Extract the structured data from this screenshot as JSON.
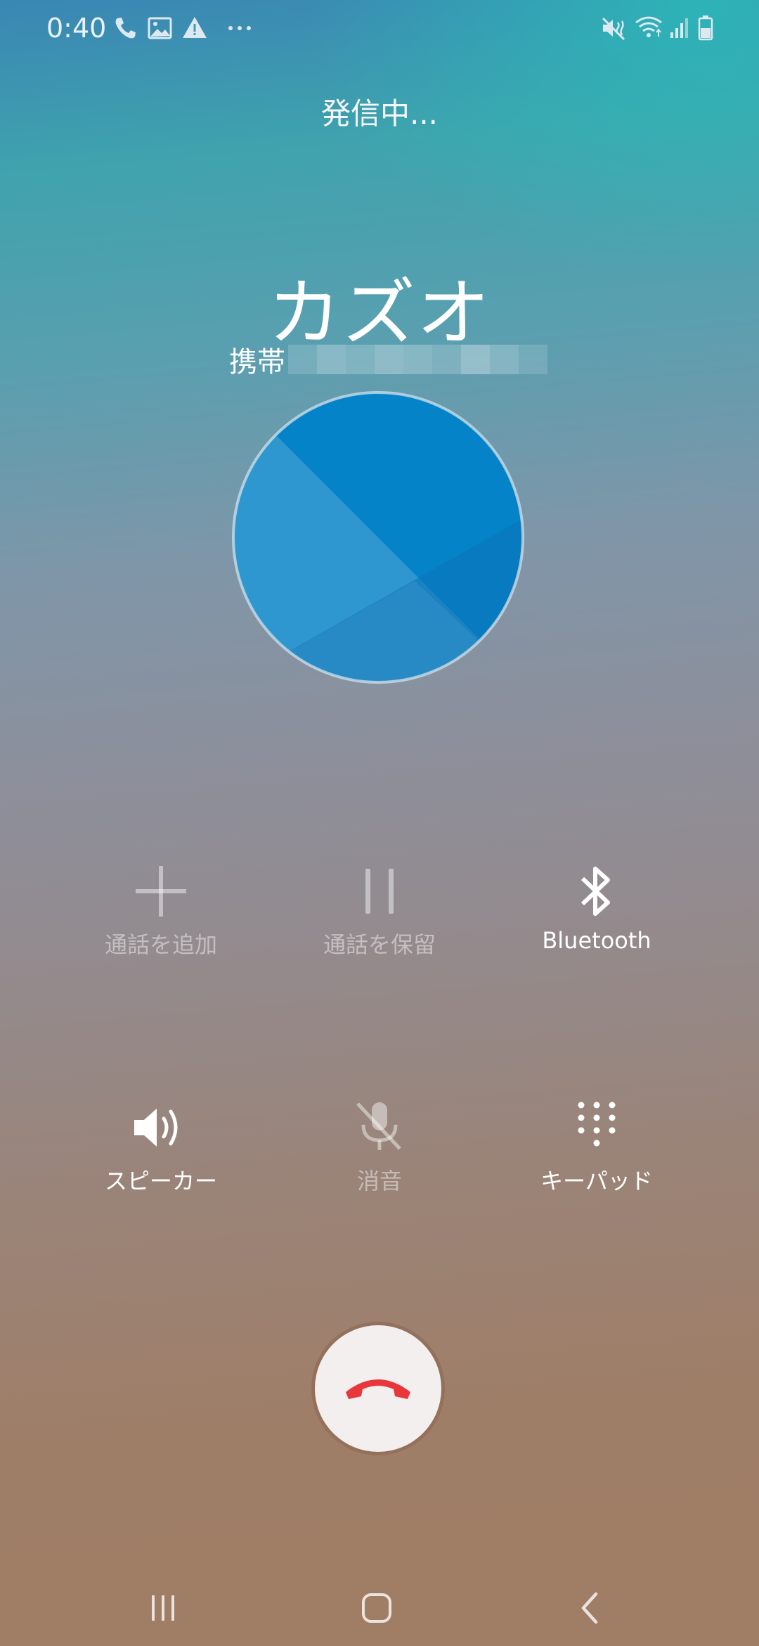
{
  "status_bar": {
    "time": "0:40",
    "left_icons": [
      "phone-icon",
      "image-icon",
      "warning-icon",
      "more-dots-icon"
    ],
    "right_icons": [
      "mute-vibrate-icon",
      "wifi-icon",
      "signal-icon",
      "battery-icon"
    ]
  },
  "call": {
    "status": "発信中...",
    "contact_name": "カズオ",
    "number_label": "携帯",
    "number_masked": true
  },
  "actions": [
    {
      "label": "通話を追加",
      "icon": "add-icon",
      "enabled": false
    },
    {
      "label": "通話を保留",
      "icon": "pause-icon",
      "enabled": false
    },
    {
      "label": "Bluetooth",
      "icon": "bluetooth-icon",
      "enabled": true
    },
    {
      "label": "スピーカー",
      "icon": "speaker-icon",
      "enabled": true
    },
    {
      "label": "消音",
      "icon": "mic-off-icon",
      "enabled": false
    },
    {
      "label": "キーパッド",
      "icon": "keypad-icon",
      "enabled": true
    }
  ],
  "end_call": {
    "icon": "end-call-icon",
    "color": "#e8373b"
  },
  "navigation": [
    "recents-icon",
    "home-icon",
    "back-icon"
  ]
}
